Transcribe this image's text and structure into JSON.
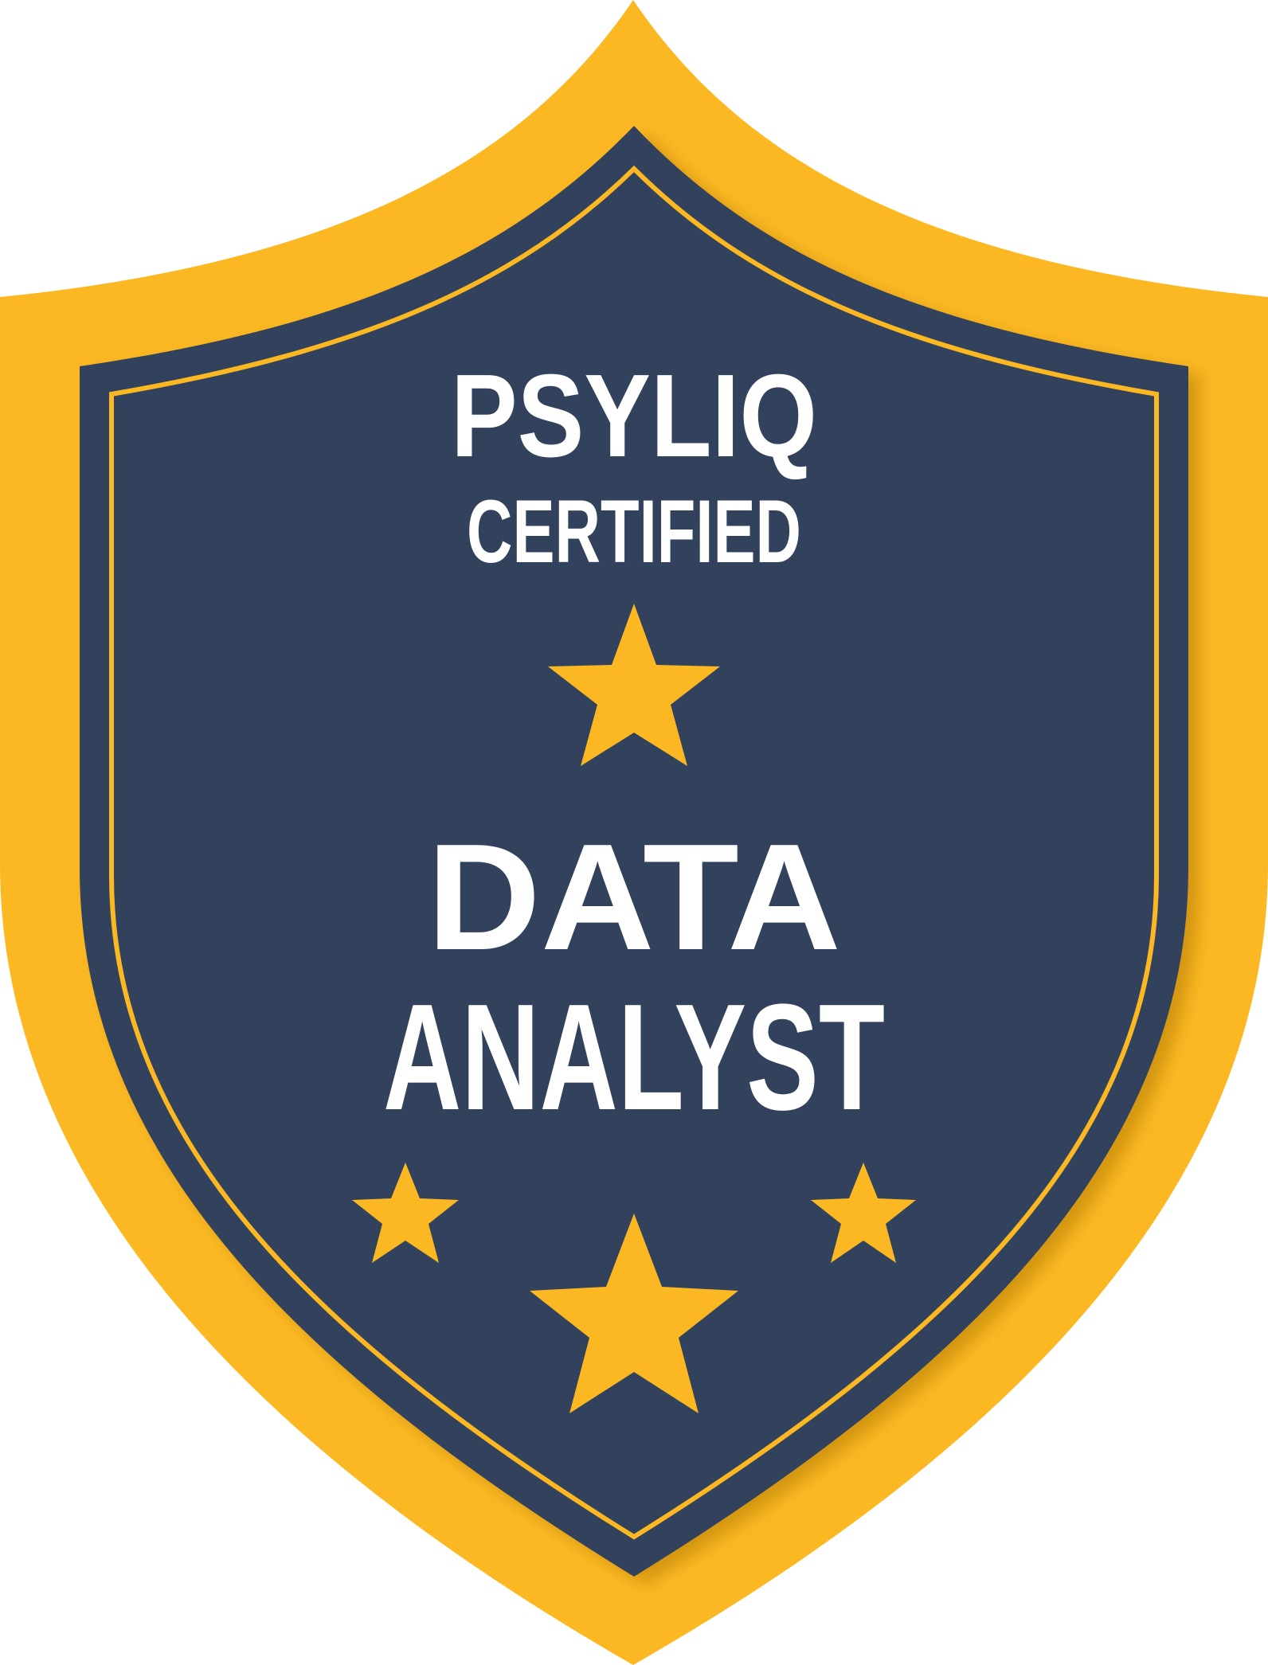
{
  "badge": {
    "brand": "PSYLIQ",
    "subtitle": "CERTIFIED",
    "title_line1": "DATA",
    "title_line2": "ANALYST",
    "star_count": 4
  },
  "colors": {
    "outer_shield": "#FBB823",
    "inner_shield": "#33435C",
    "trim_line": "#FBB823",
    "stars": "#FBB823",
    "text": "#FFFFFF",
    "background": "#FFFFFF"
  }
}
